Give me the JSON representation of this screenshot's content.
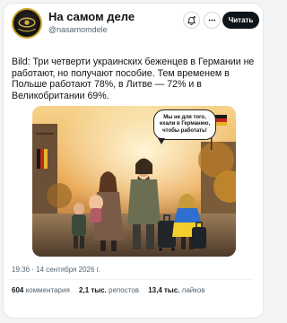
{
  "account": {
    "name": "На самом деле",
    "handle": "@nasamomdele",
    "avatar_icon": "eye-logo-icon"
  },
  "header": {
    "notify_icon": "bell-plus-icon",
    "more_icon": "more-horizontal-icon",
    "read_label": "Читать"
  },
  "post": {
    "text": "Bild: Три четверти украинских беженцев в Германии не работают, но получают пособие. Тем временем в Польше работают 78%, в Литве — 72% и в Великобритании 69%.",
    "image": {
      "speech_bubble": "Мы не для того, ехали в Германию, чтобы работать!"
    },
    "timestamp": "19:36 · 14 сентября 2026 г.",
    "stats": {
      "comments_count": "604",
      "comments_label": "комментария",
      "reposts_count": "2,1 тыс.",
      "reposts_label": "репостов",
      "likes_count": "13,4 тыс.",
      "likes_label": "лайков"
    }
  },
  "colors": {
    "primary_text": "#0f1419",
    "secondary_text": "#536471",
    "button_bg": "#0f1419",
    "avatar_ring": "#c9a227"
  }
}
